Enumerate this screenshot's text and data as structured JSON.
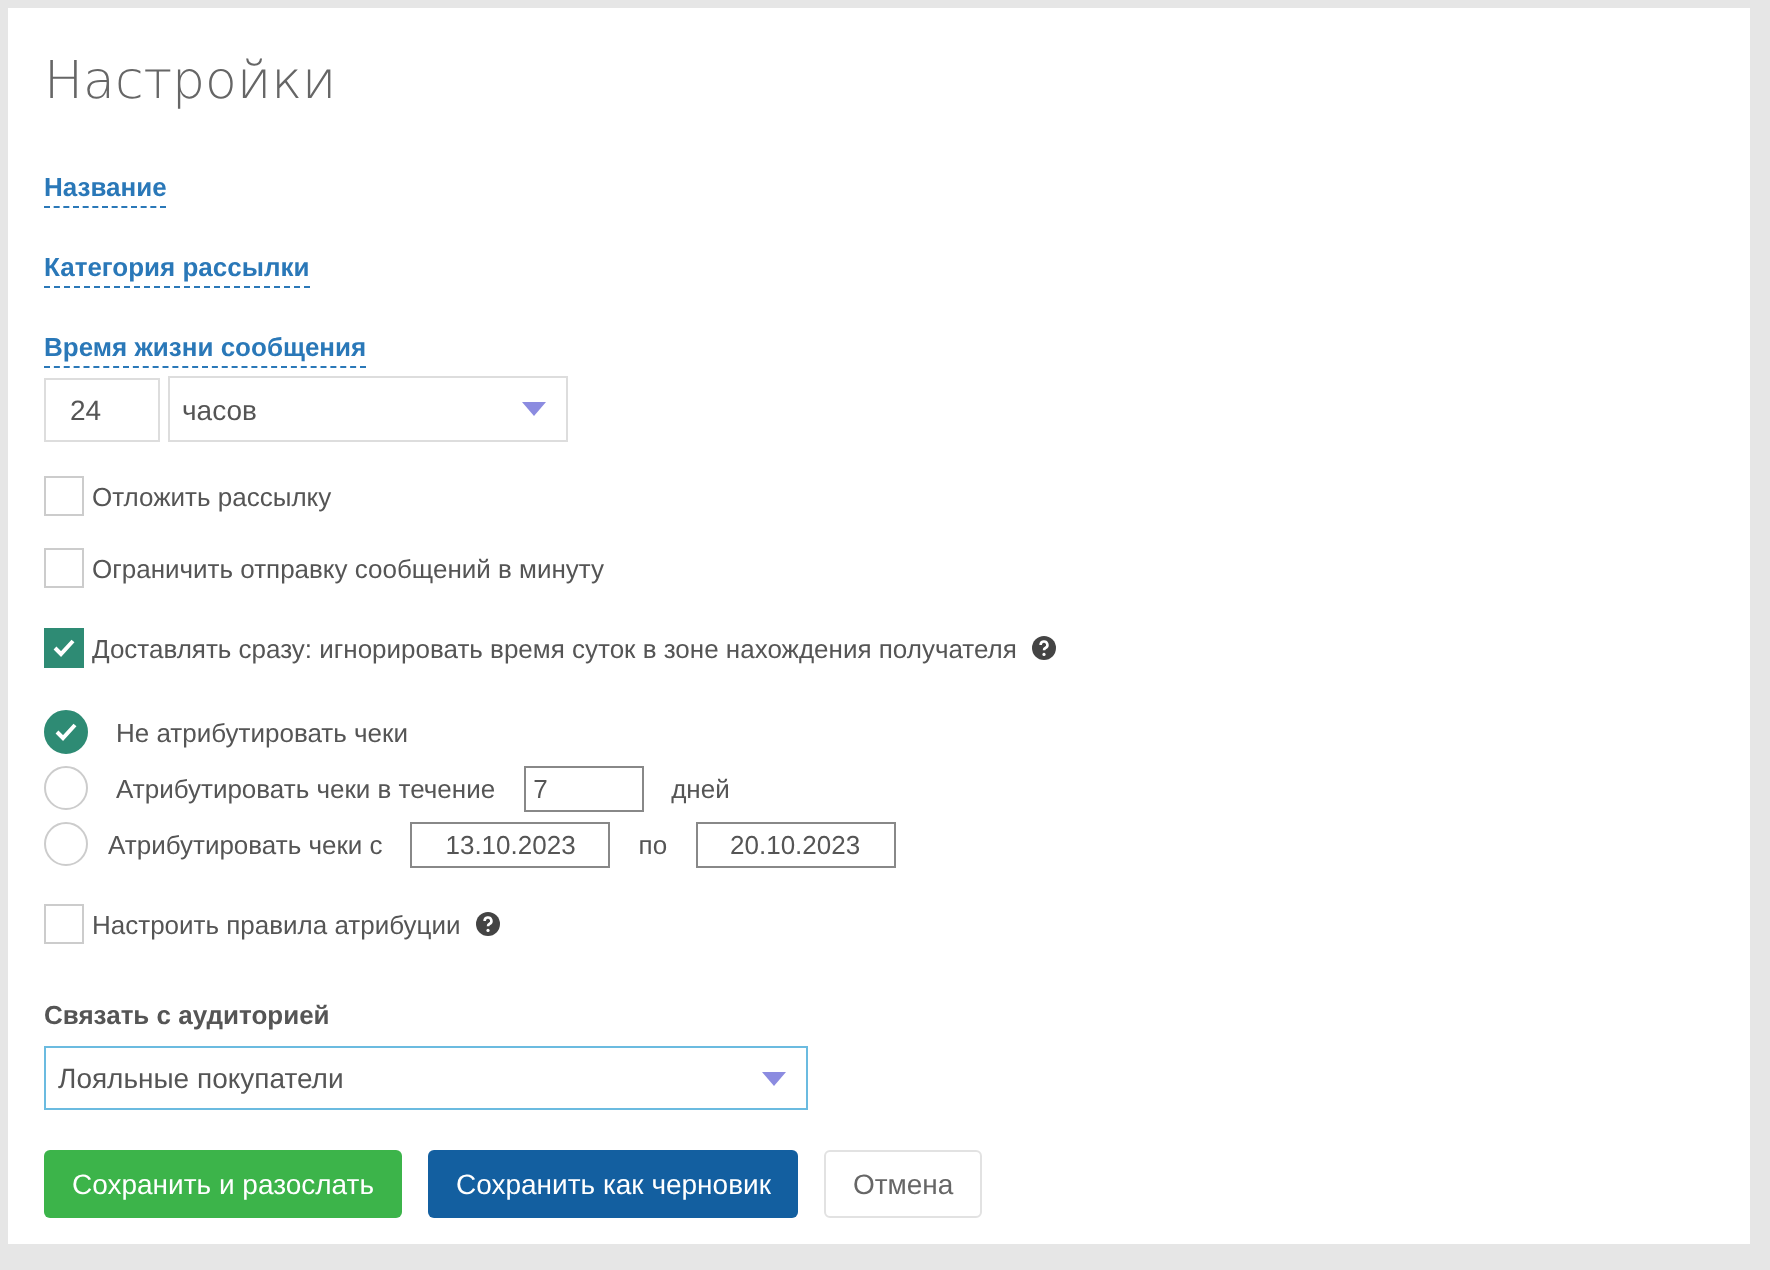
{
  "title": "Настройки",
  "sections": [
    "Название",
    "Категория рассылки",
    "Время жизни сообщения"
  ],
  "lifetime": {
    "value": "24",
    "unit": "часов"
  },
  "checkboxes": [
    {
      "label": "Отложить рассылку",
      "checked": false,
      "help": false
    },
    {
      "label": "Ограничить отправку сообщений в минуту",
      "checked": false,
      "help": false
    },
    {
      "label": "Доставлять сразу: игнорировать время суток в зоне нахождения получателя",
      "checked": true,
      "help": true
    }
  ],
  "attribution": [
    {
      "kind": "plain",
      "label": "Не атрибутировать чеки",
      "selected": true
    },
    {
      "kind": "days",
      "label": "Атрибутировать чеки в течение",
      "value": "7",
      "suffix": "дней",
      "selected": false
    },
    {
      "kind": "range",
      "label": "Атрибутировать чеки с",
      "from": "13.10.2023",
      "separator": "по",
      "to": "20.10.2023",
      "selected": false
    }
  ],
  "rules": {
    "label": "Настроить правила атрибуции",
    "checked": false,
    "help": true
  },
  "audience": {
    "label": "Связать с аудиторией",
    "value": "Лояльные покупатели"
  },
  "buttons": [
    {
      "kind": "primary",
      "label": "Сохранить и разослать"
    },
    {
      "kind": "secondary",
      "label": "Сохранить как черновик"
    },
    {
      "kind": "cancel",
      "label": "Отмена"
    }
  ]
}
